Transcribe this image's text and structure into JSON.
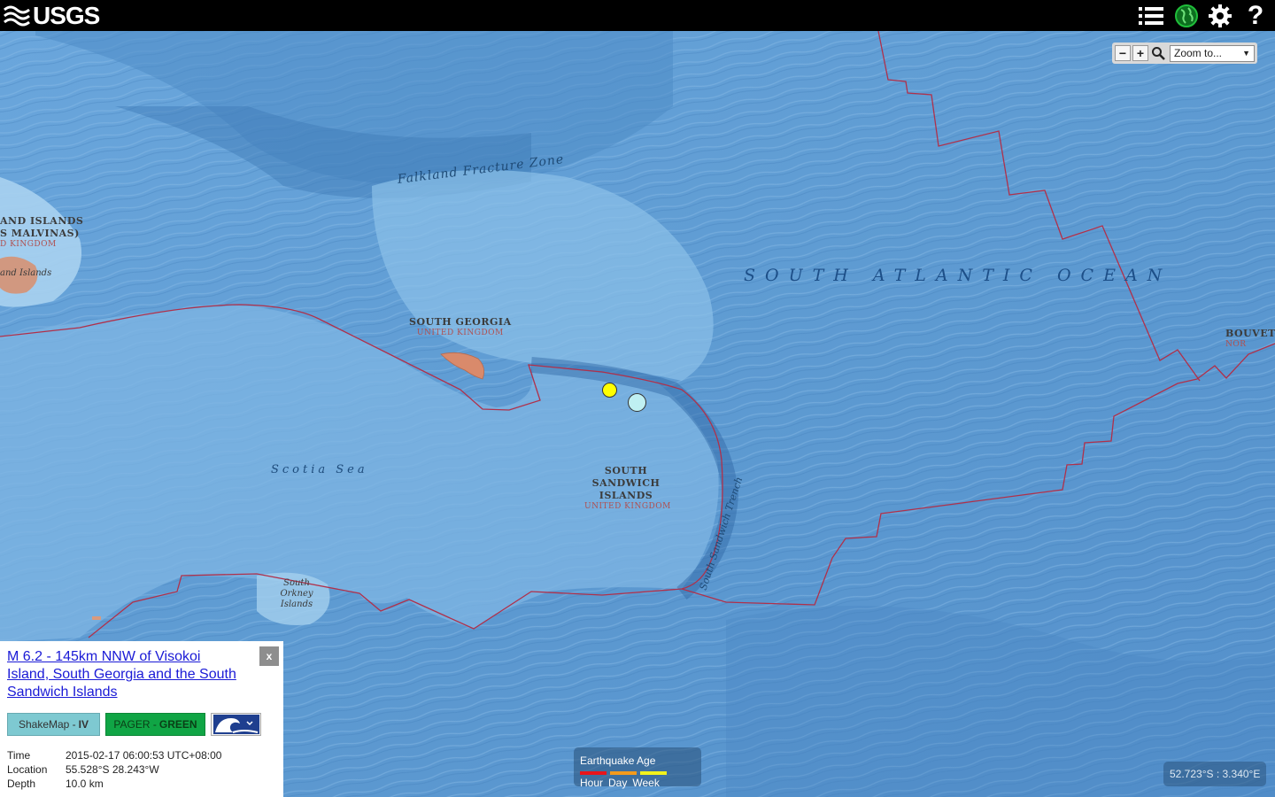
{
  "header": {
    "logo_text": "USGS",
    "icons": [
      "list-icon",
      "globe-icon",
      "gear-icon",
      "help-icon"
    ],
    "help_glyph": "?"
  },
  "map": {
    "labels": {
      "ocean": "SOUTH ATLANTIC OCEAN",
      "scotia_sea": "Scotia Sea",
      "falkland_fz": "Falkland Fracture Zone",
      "trench": "South Sandwich Trench",
      "south_georgia": "SOUTH GEORGIA",
      "south_georgia_sov": "UNITED KINGDOM",
      "ssi_line1": "SOUTH",
      "ssi_line2": "SANDWICH",
      "ssi_line3": "ISLANDS",
      "ssi_sov": "UNITED KINGDOM",
      "falkland_line1": "AND ISLANDS",
      "falkland_line2": "S MALVINAS)",
      "falkland_sov": "D KINGDOM",
      "falkland_small": "and Islands",
      "south_orkney_1": "South",
      "south_orkney_2": "Orkney",
      "south_orkney_3": "Islands",
      "bouvet": "BOUVET",
      "bouvet_sov": "NOR"
    },
    "markers": [
      {
        "name": "earthquake-marker-day",
        "color": "#ffff00"
      },
      {
        "name": "earthquake-marker-selected",
        "color": "#bff0f2"
      }
    ],
    "colors": {
      "plate_boundary": "#b0304a",
      "deep_ocean": "#5b97cf",
      "shelf": "#9fcbea"
    }
  },
  "zoom": {
    "minus": "−",
    "plus": "+",
    "select_value": "Zoom to..."
  },
  "popup": {
    "title": "M 6.2 - 145km NNW of Visokoi Island, South Georgia and the South Sandwich Islands",
    "close": "x",
    "shakemap_label": "ShakeMap - ",
    "shakemap_value": "IV",
    "pager_label": "PAGER - ",
    "pager_value": "GREEN",
    "shakemap_color": "#7ec9d1",
    "pager_color": "#10a545",
    "details": [
      {
        "key": "Time",
        "value": "2015-02-17 06:00:53 UTC+08:00"
      },
      {
        "key": "Location",
        "value": "55.528°S 28.243°W"
      },
      {
        "key": "Depth",
        "value": "10.0 km"
      }
    ]
  },
  "legend": {
    "title": "Earthquake Age",
    "items": [
      {
        "label": "Hour",
        "color": "#e8141b"
      },
      {
        "label": "Day",
        "color": "#f39a1c"
      },
      {
        "label": "Week",
        "color": "#f2f21c"
      }
    ]
  },
  "coords": "52.723°S : 3.340°E"
}
